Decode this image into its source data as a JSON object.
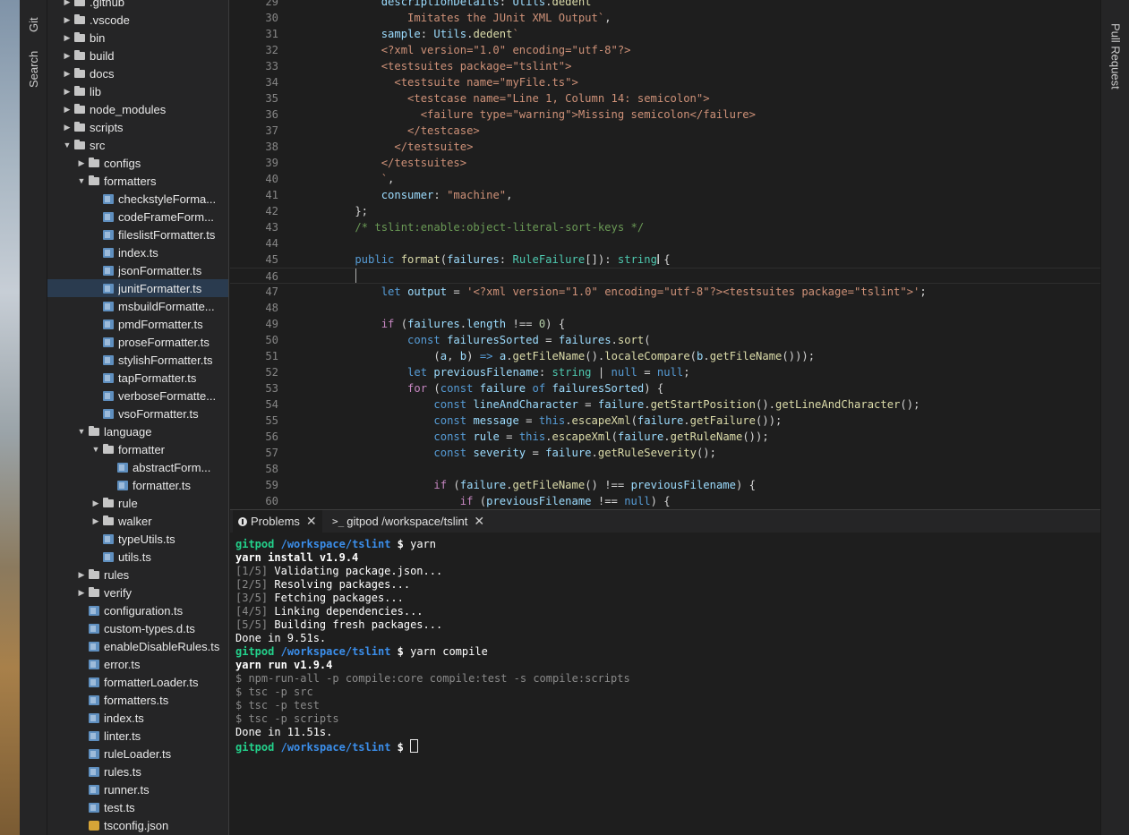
{
  "left_bar": {
    "tabs": [
      "Git",
      "Search"
    ]
  },
  "right_bar": {
    "tabs": [
      "Pull Request"
    ]
  },
  "explorer": {
    "items": [
      {
        "label": ".github",
        "indent": 1,
        "type": "folder",
        "expanded": false
      },
      {
        "label": ".vscode",
        "indent": 1,
        "type": "folder",
        "expanded": false
      },
      {
        "label": "bin",
        "indent": 1,
        "type": "folder",
        "expanded": false
      },
      {
        "label": "build",
        "indent": 1,
        "type": "folder",
        "expanded": false
      },
      {
        "label": "docs",
        "indent": 1,
        "type": "folder",
        "expanded": false
      },
      {
        "label": "lib",
        "indent": 1,
        "type": "folder",
        "expanded": false
      },
      {
        "label": "node_modules",
        "indent": 1,
        "type": "folder",
        "expanded": false
      },
      {
        "label": "scripts",
        "indent": 1,
        "type": "folder",
        "expanded": false
      },
      {
        "label": "src",
        "indent": 1,
        "type": "folder",
        "expanded": true
      },
      {
        "label": "configs",
        "indent": 2,
        "type": "folder",
        "expanded": false
      },
      {
        "label": "formatters",
        "indent": 2,
        "type": "folder",
        "expanded": true
      },
      {
        "label": "checkstyleForma...",
        "indent": 3,
        "type": "ts"
      },
      {
        "label": "codeFrameForm...",
        "indent": 3,
        "type": "ts"
      },
      {
        "label": "fileslistFormatter.ts",
        "indent": 3,
        "type": "ts"
      },
      {
        "label": "index.ts",
        "indent": 3,
        "type": "ts"
      },
      {
        "label": "jsonFormatter.ts",
        "indent": 3,
        "type": "ts"
      },
      {
        "label": "junitFormatter.ts",
        "indent": 3,
        "type": "ts",
        "selected": true
      },
      {
        "label": "msbuildFormatte...",
        "indent": 3,
        "type": "ts"
      },
      {
        "label": "pmdFormatter.ts",
        "indent": 3,
        "type": "ts"
      },
      {
        "label": "proseFormatter.ts",
        "indent": 3,
        "type": "ts"
      },
      {
        "label": "stylishFormatter.ts",
        "indent": 3,
        "type": "ts"
      },
      {
        "label": "tapFormatter.ts",
        "indent": 3,
        "type": "ts"
      },
      {
        "label": "verboseFormatte...",
        "indent": 3,
        "type": "ts"
      },
      {
        "label": "vsoFormatter.ts",
        "indent": 3,
        "type": "ts"
      },
      {
        "label": "language",
        "indent": 2,
        "type": "folder",
        "expanded": true
      },
      {
        "label": "formatter",
        "indent": 3,
        "type": "folder",
        "expanded": true
      },
      {
        "label": "abstractForm...",
        "indent": 4,
        "type": "ts"
      },
      {
        "label": "formatter.ts",
        "indent": 4,
        "type": "ts"
      },
      {
        "label": "rule",
        "indent": 3,
        "type": "folder",
        "expanded": false
      },
      {
        "label": "walker",
        "indent": 3,
        "type": "folder",
        "expanded": false
      },
      {
        "label": "typeUtils.ts",
        "indent": 3,
        "type": "ts"
      },
      {
        "label": "utils.ts",
        "indent": 3,
        "type": "ts"
      },
      {
        "label": "rules",
        "indent": 2,
        "type": "folder",
        "expanded": false
      },
      {
        "label": "verify",
        "indent": 2,
        "type": "folder",
        "expanded": false
      },
      {
        "label": "configuration.ts",
        "indent": 2,
        "type": "ts"
      },
      {
        "label": "custom-types.d.ts",
        "indent": 2,
        "type": "ts"
      },
      {
        "label": "enableDisableRules.ts",
        "indent": 2,
        "type": "ts"
      },
      {
        "label": "error.ts",
        "indent": 2,
        "type": "ts"
      },
      {
        "label": "formatterLoader.ts",
        "indent": 2,
        "type": "ts"
      },
      {
        "label": "formatters.ts",
        "indent": 2,
        "type": "ts"
      },
      {
        "label": "index.ts",
        "indent": 2,
        "type": "ts"
      },
      {
        "label": "linter.ts",
        "indent": 2,
        "type": "ts"
      },
      {
        "label": "ruleLoader.ts",
        "indent": 2,
        "type": "ts"
      },
      {
        "label": "rules.ts",
        "indent": 2,
        "type": "ts"
      },
      {
        "label": "runner.ts",
        "indent": 2,
        "type": "ts"
      },
      {
        "label": "test.ts",
        "indent": 2,
        "type": "ts"
      },
      {
        "label": "tsconfig.json",
        "indent": 2,
        "type": "json"
      }
    ]
  },
  "editor": {
    "current_line": 46,
    "lines": [
      {
        "n": "29",
        "tokens": [
          [
            "var",
            "        descriptionDetails"
          ],
          [
            "pun",
            ": "
          ],
          [
            "var",
            "Utils"
          ],
          [
            "pun",
            "."
          ],
          [
            "fn",
            "dedent"
          ],
          [
            "str",
            "`"
          ]
        ]
      },
      {
        "n": "30",
        "tokens": [
          [
            "str",
            "            Imitates the JUnit XML Output`"
          ],
          [
            "pun",
            ","
          ]
        ]
      },
      {
        "n": "31",
        "tokens": [
          [
            "var",
            "        sample"
          ],
          [
            "pun",
            ": "
          ],
          [
            "var",
            "Utils"
          ],
          [
            "pun",
            "."
          ],
          [
            "fn",
            "dedent"
          ],
          [
            "str",
            "`"
          ]
        ]
      },
      {
        "n": "32",
        "tokens": [
          [
            "str",
            "        <?xml version=\"1.0\" encoding=\"utf-8\"?>"
          ]
        ]
      },
      {
        "n": "33",
        "tokens": [
          [
            "str",
            "        <testsuites package=\"tslint\">"
          ]
        ]
      },
      {
        "n": "34",
        "tokens": [
          [
            "str",
            "          <testsuite name=\"myFile.ts\">"
          ]
        ]
      },
      {
        "n": "35",
        "tokens": [
          [
            "str",
            "            <testcase name=\"Line 1, Column 14: semicolon\">"
          ]
        ]
      },
      {
        "n": "36",
        "tokens": [
          [
            "str",
            "              <failure type=\"warning\">Missing semicolon</failure>"
          ]
        ]
      },
      {
        "n": "37",
        "tokens": [
          [
            "str",
            "            </testcase>"
          ]
        ]
      },
      {
        "n": "38",
        "tokens": [
          [
            "str",
            "          </testsuite>"
          ]
        ]
      },
      {
        "n": "39",
        "tokens": [
          [
            "str",
            "        </testsuites>"
          ]
        ]
      },
      {
        "n": "40",
        "tokens": [
          [
            "str",
            "        `"
          ],
          [
            "pun",
            ","
          ]
        ]
      },
      {
        "n": "41",
        "tokens": [
          [
            "var",
            "        consumer"
          ],
          [
            "pun",
            ": "
          ],
          [
            "str",
            "\"machine\""
          ],
          [
            "pun",
            ","
          ]
        ]
      },
      {
        "n": "42",
        "tokens": [
          [
            "pun",
            "    };"
          ]
        ]
      },
      {
        "n": "43",
        "tokens": [
          [
            "cmt",
            "    /* tslint:enable:object-literal-sort-keys */"
          ]
        ]
      },
      {
        "n": "44",
        "tokens": []
      },
      {
        "n": "45",
        "tokens": [
          [
            "kw",
            "    public "
          ],
          [
            "fn",
            "format"
          ],
          [
            "pun",
            "("
          ],
          [
            "var",
            "failures"
          ],
          [
            "pun",
            ": "
          ],
          [
            "type",
            "RuleFailure"
          ],
          [
            "pun",
            "[]): "
          ],
          [
            "type",
            "string"
          ],
          [
            "pun",
            " {"
          ]
        ]
      },
      {
        "n": "46",
        "tokens": []
      },
      {
        "n": "47",
        "tokens": [
          [
            "kw",
            "        let "
          ],
          [
            "var",
            "output"
          ],
          [
            "pun",
            " = "
          ],
          [
            "str",
            "'<?xml version=\"1.0\" encoding=\"utf-8\"?><testsuites package=\"tslint\">'"
          ],
          [
            "pun",
            ";"
          ]
        ]
      },
      {
        "n": "48",
        "tokens": []
      },
      {
        "n": "49",
        "tokens": [
          [
            "ctl",
            "        if "
          ],
          [
            "pun",
            "("
          ],
          [
            "var",
            "failures"
          ],
          [
            "pun",
            "."
          ],
          [
            "var",
            "length"
          ],
          [
            "pun",
            " !== "
          ],
          [
            "num",
            "0"
          ],
          [
            "pun",
            ") {"
          ]
        ]
      },
      {
        "n": "50",
        "tokens": [
          [
            "kw",
            "            const "
          ],
          [
            "var",
            "failuresSorted"
          ],
          [
            "pun",
            " = "
          ],
          [
            "var",
            "failures"
          ],
          [
            "pun",
            "."
          ],
          [
            "fn",
            "sort"
          ],
          [
            "pun",
            "("
          ]
        ]
      },
      {
        "n": "51",
        "tokens": [
          [
            "pun",
            "                ("
          ],
          [
            "var",
            "a"
          ],
          [
            "pun",
            ", "
          ],
          [
            "var",
            "b"
          ],
          [
            "pun",
            ") "
          ],
          [
            "kw",
            "=>"
          ],
          [
            "pun",
            " "
          ],
          [
            "var",
            "a"
          ],
          [
            "pun",
            "."
          ],
          [
            "fn",
            "getFileName"
          ],
          [
            "pun",
            "()."
          ],
          [
            "fn",
            "localeCompare"
          ],
          [
            "pun",
            "("
          ],
          [
            "var",
            "b"
          ],
          [
            "pun",
            "."
          ],
          [
            "fn",
            "getFileName"
          ],
          [
            "pun",
            "()));"
          ]
        ]
      },
      {
        "n": "52",
        "tokens": [
          [
            "kw",
            "            let "
          ],
          [
            "var",
            "previousFilename"
          ],
          [
            "pun",
            ": "
          ],
          [
            "type",
            "string"
          ],
          [
            "pun",
            " | "
          ],
          [
            "kw",
            "null"
          ],
          [
            "pun",
            " = "
          ],
          [
            "kw",
            "null"
          ],
          [
            "pun",
            ";"
          ]
        ]
      },
      {
        "n": "53",
        "tokens": [
          [
            "ctl",
            "            for "
          ],
          [
            "pun",
            "("
          ],
          [
            "kw",
            "const "
          ],
          [
            "var",
            "failure"
          ],
          [
            "kw",
            " of "
          ],
          [
            "var",
            "failuresSorted"
          ],
          [
            "pun",
            ") {"
          ]
        ]
      },
      {
        "n": "54",
        "tokens": [
          [
            "kw",
            "                const "
          ],
          [
            "var",
            "lineAndCharacter"
          ],
          [
            "pun",
            " = "
          ],
          [
            "var",
            "failure"
          ],
          [
            "pun",
            "."
          ],
          [
            "fn",
            "getStartPosition"
          ],
          [
            "pun",
            "()."
          ],
          [
            "fn",
            "getLineAndCharacter"
          ],
          [
            "pun",
            "();"
          ]
        ]
      },
      {
        "n": "55",
        "tokens": [
          [
            "kw",
            "                const "
          ],
          [
            "var",
            "message"
          ],
          [
            "pun",
            " = "
          ],
          [
            "kw",
            "this"
          ],
          [
            "pun",
            "."
          ],
          [
            "fn",
            "escapeXml"
          ],
          [
            "pun",
            "("
          ],
          [
            "var",
            "failure"
          ],
          [
            "pun",
            "."
          ],
          [
            "fn",
            "getFailure"
          ],
          [
            "pun",
            "());"
          ]
        ]
      },
      {
        "n": "56",
        "tokens": [
          [
            "kw",
            "                const "
          ],
          [
            "var",
            "rule"
          ],
          [
            "pun",
            " = "
          ],
          [
            "kw",
            "this"
          ],
          [
            "pun",
            "."
          ],
          [
            "fn",
            "escapeXml"
          ],
          [
            "pun",
            "("
          ],
          [
            "var",
            "failure"
          ],
          [
            "pun",
            "."
          ],
          [
            "fn",
            "getRuleName"
          ],
          [
            "pun",
            "());"
          ]
        ]
      },
      {
        "n": "57",
        "tokens": [
          [
            "kw",
            "                const "
          ],
          [
            "var",
            "severity"
          ],
          [
            "pun",
            " = "
          ],
          [
            "var",
            "failure"
          ],
          [
            "pun",
            "."
          ],
          [
            "fn",
            "getRuleSeverity"
          ],
          [
            "pun",
            "();"
          ]
        ]
      },
      {
        "n": "58",
        "tokens": []
      },
      {
        "n": "59",
        "tokens": [
          [
            "ctl",
            "                if "
          ],
          [
            "pun",
            "("
          ],
          [
            "var",
            "failure"
          ],
          [
            "pun",
            "."
          ],
          [
            "fn",
            "getFileName"
          ],
          [
            "pun",
            "() !== "
          ],
          [
            "var",
            "previousFilename"
          ],
          [
            "pun",
            ") {"
          ]
        ]
      },
      {
        "n": "60",
        "tokens": [
          [
            "ctl",
            "                    if "
          ],
          [
            "pun",
            "("
          ],
          [
            "var",
            "previousFilename"
          ],
          [
            "pun",
            " !== "
          ],
          [
            "kw",
            "null"
          ],
          [
            "pun",
            ") {"
          ]
        ]
      }
    ]
  },
  "panel": {
    "tabs": [
      {
        "icon": "info-icon",
        "label": "Problems",
        "close": "✕"
      },
      {
        "icon": "terminal-icon",
        "label": "gitpod /workspace/tslint",
        "close": "✕"
      }
    ]
  },
  "terminal": {
    "lines": [
      [
        [
          "green",
          "gitpod"
        ],
        [
          "plain",
          " "
        ],
        [
          "blue",
          "/workspace/tslint"
        ],
        [
          "bold",
          " $ "
        ],
        [
          "white",
          "yarn"
        ]
      ],
      [
        [
          "bold",
          "yarn install v1.9.4"
        ]
      ],
      [
        [
          "dim",
          "[1/5]"
        ],
        [
          "white",
          " Validating package.json..."
        ]
      ],
      [
        [
          "dim",
          "[2/5]"
        ],
        [
          "white",
          " Resolving packages..."
        ]
      ],
      [
        [
          "dim",
          "[3/5]"
        ],
        [
          "white",
          " Fetching packages..."
        ]
      ],
      [
        [
          "dim",
          "[4/5]"
        ],
        [
          "white",
          " Linking dependencies..."
        ]
      ],
      [
        [
          "dim",
          "[5/5]"
        ],
        [
          "white",
          " Building fresh packages..."
        ]
      ],
      [
        [
          "white",
          "Done in 9.51s."
        ]
      ],
      [
        [
          "green",
          "gitpod"
        ],
        [
          "plain",
          " "
        ],
        [
          "blue",
          "/workspace/tslint"
        ],
        [
          "bold",
          " $ "
        ],
        [
          "white",
          "yarn compile"
        ]
      ],
      [
        [
          "bold",
          "yarn run v1.9.4"
        ]
      ],
      [
        [
          "dim",
          "$ npm-run-all -p compile:core compile:test -s compile:scripts"
        ]
      ],
      [
        [
          "dim",
          "$ tsc -p src"
        ]
      ],
      [
        [
          "dim",
          "$ tsc -p test"
        ]
      ],
      [
        [
          "dim",
          "$ tsc -p scripts"
        ]
      ],
      [
        [
          "white",
          "Done in 11.51s."
        ]
      ],
      [
        [
          "green",
          "gitpod"
        ],
        [
          "plain",
          " "
        ],
        [
          "blue",
          "/workspace/tslint"
        ],
        [
          "bold",
          " $ "
        ],
        [
          "cursor",
          ""
        ]
      ]
    ]
  },
  "colors": {
    "accent": "#007acc",
    "selection": "#2a3b4f",
    "prompt_green": "#23d18b",
    "prompt_blue": "#3b8eea"
  }
}
